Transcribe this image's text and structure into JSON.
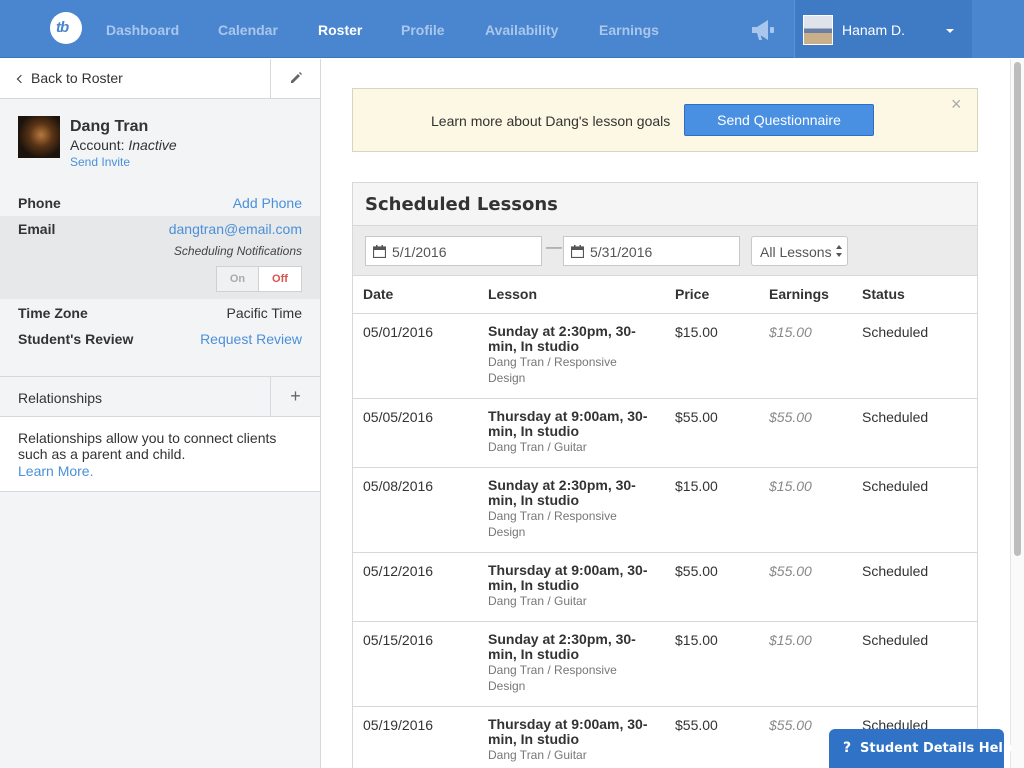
{
  "nav": {
    "logo_text": "tb",
    "items": [
      {
        "label": "Dashboard",
        "active": false
      },
      {
        "label": "Calendar",
        "active": false
      },
      {
        "label": "Roster",
        "active": true
      },
      {
        "label": "Profile",
        "active": false
      },
      {
        "label": "Availability",
        "active": false
      },
      {
        "label": "Earnings",
        "active": false
      }
    ],
    "user_name": "Hanam D."
  },
  "sidebar": {
    "back_label": "Back to Roster",
    "student": {
      "name": "Dang Tran",
      "account_label": "Account:",
      "account_status": "Inactive",
      "send_invite": "Send Invite"
    },
    "phone": {
      "label": "Phone",
      "value": "Add Phone"
    },
    "email": {
      "label": "Email",
      "value": "dangtran@email.com",
      "note": "Scheduling Notifications",
      "toggle_on": "On",
      "toggle_off": "Off",
      "toggle_state": "Off"
    },
    "time_zone": {
      "label": "Time Zone",
      "value": "Pacific Time"
    },
    "review": {
      "label": "Student's Review",
      "value": "Request Review"
    },
    "relationships": {
      "title": "Relationships",
      "add": "+",
      "description": "Relationships allow you to connect clients such as a parent and child.",
      "learn_more": "Learn More."
    }
  },
  "banner": {
    "text": "Learn more about Dang's lesson goals",
    "button": "Send Questionnaire",
    "close": "×"
  },
  "lessons": {
    "title": "Scheduled Lessons",
    "start_date": "5/1/2016",
    "end_date": "5/31/2016",
    "filter": "All Lessons",
    "columns": [
      "Date",
      "Lesson",
      "Price",
      "Earnings",
      "Status"
    ],
    "rows": [
      {
        "date": "05/01/2016",
        "title": "Sunday at 2:30pm, 30-min, In studio",
        "sub": "Dang Tran / Responsive Design",
        "price": "$15.00",
        "earnings": "$15.00",
        "status": "Scheduled"
      },
      {
        "date": "05/05/2016",
        "title": "Thursday at 9:00am, 30-min, In studio",
        "sub": "Dang Tran / Guitar",
        "price": "$55.00",
        "earnings": "$55.00",
        "status": "Scheduled"
      },
      {
        "date": "05/08/2016",
        "title": "Sunday at 2:30pm, 30-min, In studio",
        "sub": "Dang Tran / Responsive Design",
        "price": "$15.00",
        "earnings": "$15.00",
        "status": "Scheduled"
      },
      {
        "date": "05/12/2016",
        "title": "Thursday at 9:00am, 30-min, In studio",
        "sub": "Dang Tran / Guitar",
        "price": "$55.00",
        "earnings": "$55.00",
        "status": "Scheduled"
      },
      {
        "date": "05/15/2016",
        "title": "Sunday at 2:30pm, 30-min, In studio",
        "sub": "Dang Tran / Responsive Design",
        "price": "$15.00",
        "earnings": "$15.00",
        "status": "Scheduled"
      },
      {
        "date": "05/19/2016",
        "title": "Thursday at 9:00am, 30-min, In studio",
        "sub": "Dang Tran / Guitar",
        "price": "$55.00",
        "earnings": "$55.00",
        "status": "Scheduled"
      }
    ]
  },
  "help": {
    "icon": "?",
    "label": "Student Details Help"
  },
  "colors": {
    "nav_bg": "#4a86cf",
    "link": "#4a90d9",
    "banner_bg": "#fcf8e3",
    "primary_button": "#4a90e2",
    "toggle_off": "#d9534f"
  }
}
